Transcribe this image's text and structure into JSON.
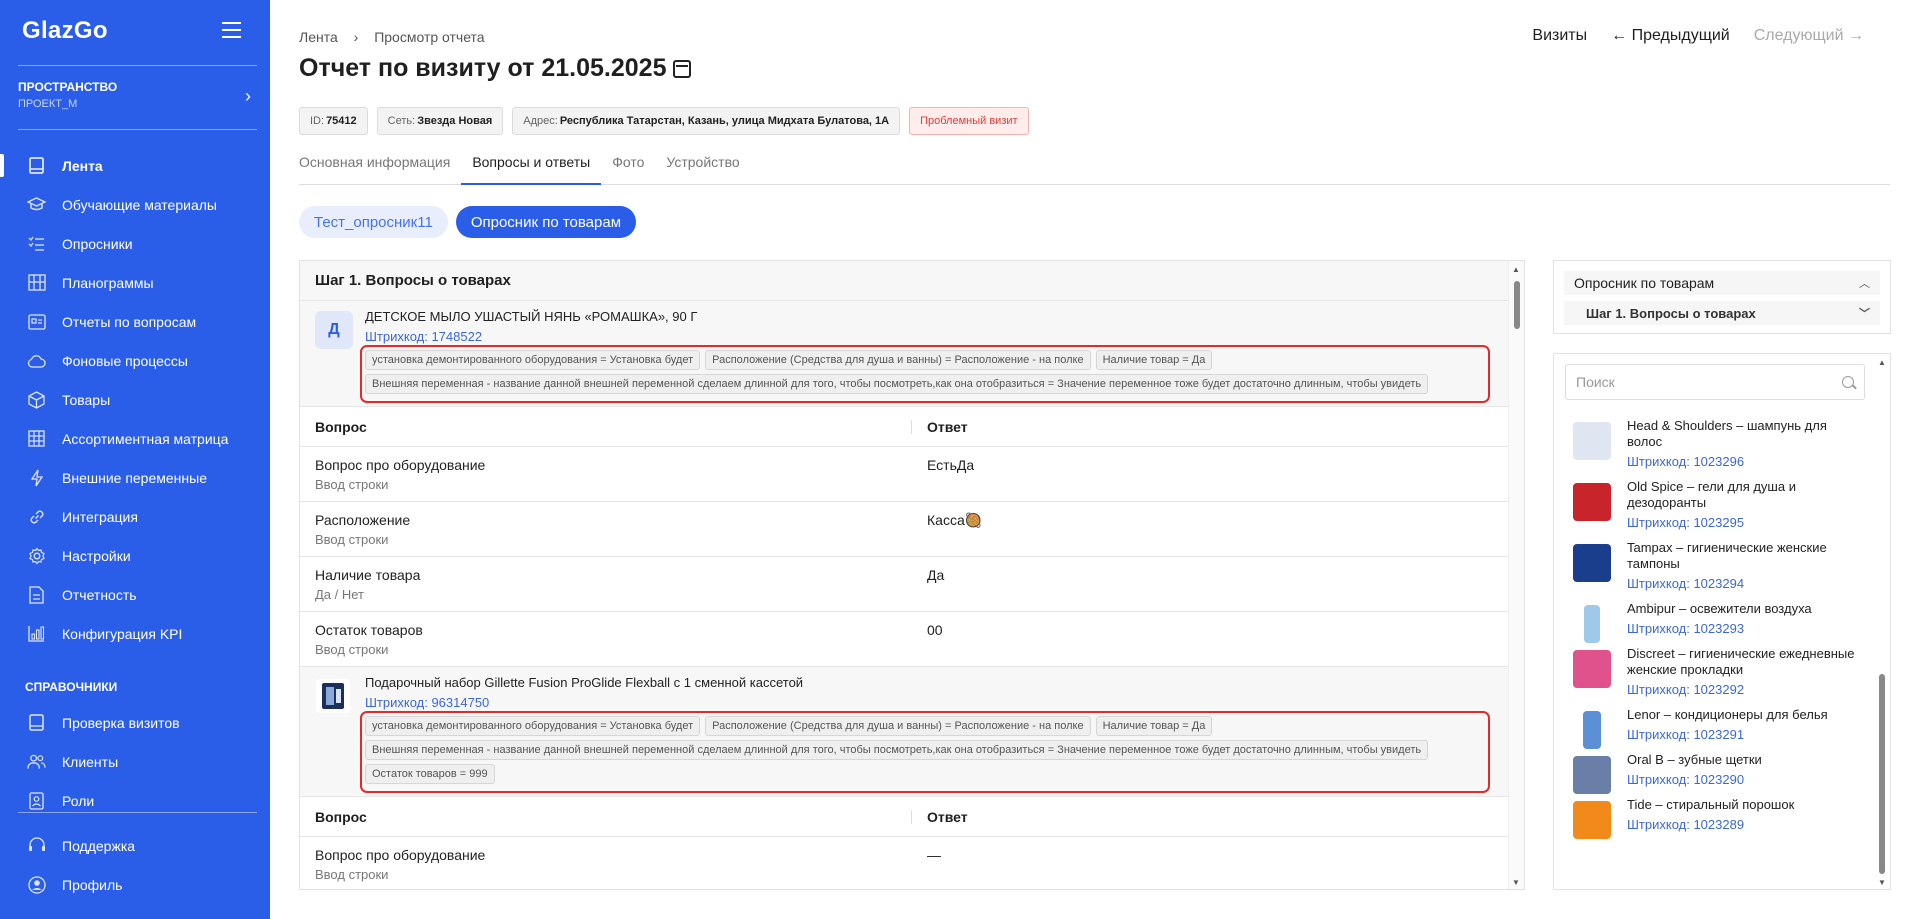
{
  "sidebar": {
    "logo": "GlazGo",
    "space_title": "ПРОСТРАНСТВО",
    "space_project": "ПРОЕКТ_М",
    "items": [
      {
        "label": "Лента",
        "icon": "tablet-icon"
      },
      {
        "label": "Обучающие материалы",
        "icon": "graduation-cap-icon"
      },
      {
        "label": "Опросники",
        "icon": "checklist-icon"
      },
      {
        "label": "Планограммы",
        "icon": "shelves-icon"
      },
      {
        "label": "Отчеты по вопросам",
        "icon": "report-icon"
      },
      {
        "label": "Фоновые процессы",
        "icon": "cloud-icon"
      },
      {
        "label": "Товары",
        "icon": "box-icon"
      },
      {
        "label": "Ассортиментная матрица",
        "icon": "grid-icon"
      },
      {
        "label": "Внешние переменные",
        "icon": "bolt-icon"
      },
      {
        "label": "Интеграция",
        "icon": "link-icon"
      },
      {
        "label": "Настройки",
        "icon": "gear-icon"
      },
      {
        "label": "Отчетность",
        "icon": "document-icon"
      },
      {
        "label": "Конфигурация KPI",
        "icon": "bar-chart-icon"
      }
    ],
    "section_title": "СПРАВОЧНИКИ",
    "ref_items": [
      {
        "label": "Проверка визитов",
        "icon": "tablet-icon"
      },
      {
        "label": "Клиенты",
        "icon": "users-icon"
      },
      {
        "label": "Роли",
        "icon": "badge-icon"
      }
    ],
    "bottom_items": [
      {
        "label": "Поддержка",
        "icon": "headset-icon"
      },
      {
        "label": "Профиль",
        "icon": "user-icon"
      }
    ]
  },
  "header": {
    "breadcrumb": [
      "Лента",
      "Просмотр отчета"
    ],
    "title": "Отчет по визиту от 21.05.2025",
    "visits": "Визиты",
    "prev": "← Предыдущий",
    "next": "Следующий →"
  },
  "tags": {
    "id_label": "ID:",
    "id_value": "75412",
    "chain_label": "Сеть:",
    "chain_value": "Звезда Новая",
    "address_label": "Адрес:",
    "address_value": "Республика Татарстан, Казань, улица Мидхата Булатова, 1А",
    "problem": "Проблемный визит"
  },
  "tabs": [
    "Основная информация",
    "Вопросы и ответы",
    "Фото",
    "Устройство"
  ],
  "chips": [
    "Тест_опросник11",
    "Опросник по товарам"
  ],
  "panel": {
    "step_title": "Шаг 1. Вопросы о товарах",
    "col_question": "Вопрос",
    "col_answer": "Ответ",
    "product1": {
      "avatar": "Д",
      "name": "ДЕТСКОЕ МЫЛО УШАСТЫЙ НЯНЬ «РОМАШКА», 90 Г",
      "code": "Штрихкод: 1748522",
      "attrs": [
        "установка демонтированного оборудования = Установка будет",
        "Расположение (Средства для душа и ванны) = Расположение - на полке",
        "Наличие товар = Да",
        "Внешняя переменная - название данной внешней переменной сделаем длинной для того, чтобы посмотреть,как она отобразиться = Значение переменное тоже будет достаточно длинным, чтобы увидеть"
      ]
    },
    "rows": [
      {
        "q": "Вопрос про оборудование",
        "h": "Ввод строки",
        "a": "ЕстьДа"
      },
      {
        "q": "Расположение",
        "h": "Ввод строки",
        "a": "Касса🥘"
      },
      {
        "q": "Наличие товара",
        "h": "Да / Нет",
        "a": "Да"
      },
      {
        "q": "Остаток товаров",
        "h": "Ввод строки",
        "a": "00"
      }
    ],
    "product2": {
      "name": "Подарочный набор Gillette Fusion ProGlide Flexball с 1 сменной кассетой",
      "code": "Штрихкод: 96314750",
      "attrs": [
        "установка демонтированного оборудования = Установка будет",
        "Расположение (Средства для душа и ванны) = Расположение - на полке",
        "Наличие товар = Да",
        "Внешняя переменная - название данной внешней переменной сделаем длинной для того, чтобы посмотреть,как она отобразиться = Значение переменное тоже будет достаточно длинным, чтобы увидеть",
        "Остаток товаров = 999"
      ]
    },
    "row2": {
      "q": "Вопрос про оборудование",
      "h": "Ввод строки",
      "a": "—"
    }
  },
  "right": {
    "acc_title": "Опросник по товарам",
    "acc_step": "Шаг 1. Вопросы о товарах",
    "search_placeholder": "Поиск",
    "products": [
      {
        "name": "Head & Shoulders – шампунь для волос",
        "code": "Штрихкод: 1023296",
        "color": "#c9d3e6"
      },
      {
        "name": "Old Spice – гели для душа и дезодоранты",
        "code": "Штрихкод: 1023295",
        "color": "#c8242c"
      },
      {
        "name": "Tampax – гигиенические женские тампоны",
        "code": "Штрихкод: 1023294",
        "color": "#1b3e8c"
      },
      {
        "name": "Ambipur – освежители воздуха",
        "code": "Штрихкод: 1023293",
        "color": "#9fc9e8"
      },
      {
        "name": "Discreet – гигиенические ежедневные женские прокладки",
        "code": "Штрихкод: 1023292",
        "color": "#e0528c"
      },
      {
        "name": "Lenor – кондиционеры для белья",
        "code": "Штрихкод: 1023291",
        "color": "#5b8fd6"
      },
      {
        "name": "Oral B – зубные щетки",
        "code": "Штрихкод: 1023290",
        "color": "#6a7fa8"
      },
      {
        "name": "Tide – стиральный порошок",
        "code": "Штрихкод: 1023289",
        "color": "#f28a1b"
      }
    ]
  }
}
